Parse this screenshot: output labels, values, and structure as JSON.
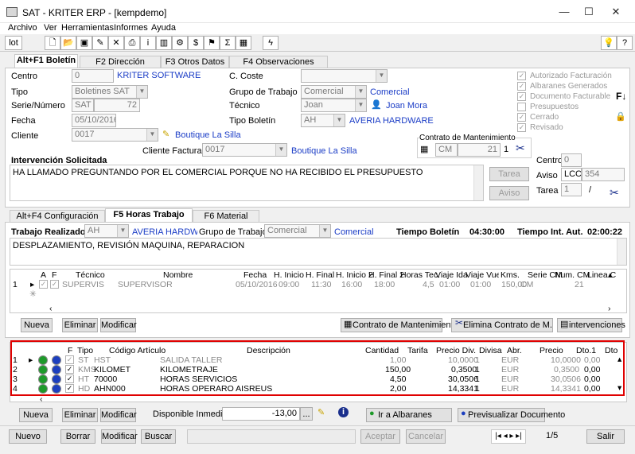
{
  "window": {
    "title": "SAT - KRITER ERP - [kempdemo]",
    "min": "—",
    "max": "☐",
    "close": "✕"
  },
  "menu": [
    "Archivo",
    "Ver",
    "Herramientas",
    "Informes",
    "Ayuda"
  ],
  "toolbar": {
    "lot": "lot"
  },
  "tabs_top": [
    "Alt+F1 Boletín",
    "F2 Dirección",
    "F3 Otros Datos",
    "F4 Observaciones"
  ],
  "header": {
    "centro_label": "Centro",
    "centro_value": "0",
    "centro_link": "KRITER SOFTWARE",
    "tipo_label": "Tipo",
    "tipo_value": "Boletines SAT",
    "serie_label": "Serie/Número",
    "serie_value": "SAT",
    "numero_value": "72",
    "fecha_label": "Fecha",
    "fecha_value": "05/10/2016",
    "cliente_label": "Cliente",
    "cliente_value": "0017",
    "cliente_link": "Boutique La Silla",
    "coste_label": "C. Coste",
    "grupo_label": "Grupo de Trabajo",
    "grupo_value": "Comercial",
    "grupo_link": "Comercial",
    "tecnico_label": "Técnico",
    "tecnico_value": "Joan",
    "tecnico_link": "Joan Mora",
    "tipobol_label": "Tipo Boletín",
    "tipobol_value": "AH",
    "tipobol_link": "AVERIA HARDWARE",
    "clifact_label": "Cliente Facturación",
    "clifact_value": "0017",
    "clifact_link": "Boutique La Silla"
  },
  "status_checks": [
    {
      "label": "Autorizado Facturación",
      "checked": true
    },
    {
      "label": "Albaranes Generados",
      "checked": true
    },
    {
      "label": "Documento Facturable",
      "checked": true
    },
    {
      "label": "Presupuestos",
      "checked": false
    },
    {
      "label": "Cerrado",
      "checked": true
    },
    {
      "label": "Revisado",
      "checked": true
    }
  ],
  "contrato": {
    "title": "Contrato de Mantenimiento",
    "code": "CM",
    "num": "21",
    "sub": "1"
  },
  "intervencion": {
    "label": "Intervención Solicitada",
    "text": "HA LLAMADO PREGUNTANDO POR EL COMERCIAL PORQUE NO HA RECIBIDO EL PRESUPUESTO",
    "tarea_btn": "Tarea",
    "aviso_btn": "Aviso"
  },
  "side": {
    "centro_label": "Centro",
    "centro_value": "0",
    "aviso_label": "Aviso",
    "aviso_code": "LCC",
    "aviso_num": "354",
    "tarea_label": "Tarea",
    "tarea_value": "1",
    "tarea_sep": "/"
  },
  "tabs_mid": [
    "Alt+F4 Configuración",
    "F5 Horas Trabajo",
    "F6 Material"
  ],
  "trabajo": {
    "label": "Trabajo Realizado",
    "tipo_value": "AH",
    "tipo_link": "AVERIA HARDWARE",
    "grupo_label": "Grupo de Trabajo",
    "grupo_value": "Comercial",
    "grupo_link": "Comercial",
    "tiempo_label": "Tiempo Boletín",
    "tiempo_value": "04:30:00",
    "int_label": "Tiempo Int. Aut.",
    "int_value": "02:00:22",
    "text": "DESPLAZAMIENTO, REVISIÓN MAQUINA, REPARACION"
  },
  "hours_table": {
    "headers": [
      "A",
      "F",
      "Técnico",
      "Nombre",
      "Fecha",
      "H. Inicio",
      "H. Final",
      "H. Inicio 2",
      "H. Final 2",
      "Horas Tec.",
      "Viaje Ida",
      "Viaje Vuelt",
      "Kms.",
      "Serie CM",
      "Num. CM",
      "Linea CM"
    ],
    "rows": [
      [
        "1",
        "SUPERVIS",
        "SUPERVISOR",
        "05/10/2016",
        "09:00",
        "11:30",
        "16:00",
        "18:00",
        "4,5",
        "01:00",
        "01:00",
        "150,00",
        "CM",
        "21"
      ]
    ],
    "new_marker": "✳"
  },
  "hours_buttons": {
    "nueva": "Nueva",
    "eliminar": "Eliminar",
    "modificar": "Modificar",
    "contrato": "Contrato de Mantenimiento",
    "elimina_contrato": "Elimina Contrato de M.",
    "intervenciones": "intervenciones"
  },
  "material_table": {
    "headers": [
      "F",
      "Tipo",
      "Código Artículo",
      "Descripción",
      "Cantidad",
      "Tarifa",
      "Precio Div.",
      "Divisa",
      "Abr.",
      "Precio",
      "Dto.1",
      "Dto"
    ],
    "rows": [
      {
        "n": "1",
        "tipo": "ST",
        "codigo": "HST",
        "desc": "SALIDA TALLER",
        "cant": "1,00",
        "precio_div": "10,0000",
        "divisa": "1",
        "abr": "EUR",
        "precio": "10,0000",
        "dto": "0,00",
        "grey": true
      },
      {
        "n": "2",
        "tipo": "KMS",
        "codigo": "KILOMET",
        "desc": "KILOMETRAJE",
        "cant": "150,00",
        "precio_div": "0,3500",
        "divisa": "1",
        "abr": "EUR",
        "precio": "0,3500",
        "dto": "0,00",
        "grey": false
      },
      {
        "n": "3",
        "tipo": "HT",
        "codigo": "70000",
        "desc": "HORAS SERVICIOS",
        "cant": "4,50",
        "precio_div": "30,0506",
        "divisa": "1",
        "abr": "EUR",
        "precio": "30,0506",
        "dto": "0,00",
        "grey": false
      },
      {
        "n": "4",
        "tipo": "HD",
        "codigo": "AHN000",
        "desc": "HORAS OPERARO AISREUS",
        "cant": "2,00",
        "precio_div": "14,3341",
        "divisa": "1",
        "abr": "EUR",
        "precio": "14,3341",
        "dto": "0,00",
        "grey": false
      }
    ]
  },
  "material_buttons": {
    "nueva": "Nueva",
    "eliminar": "Eliminar",
    "modificar": "Modificar",
    "disp_label": "Disponible Inmediato",
    "disp_value": "-13,00",
    "disp_more": "...",
    "albaranes": "Ir a Albaranes",
    "previsualizar": "Previsualizar Documento"
  },
  "footer": {
    "nuevo": "Nuevo",
    "borrar": "Borrar",
    "modificar": "Modificar",
    "buscar": "Buscar",
    "aceptar": "Aceptar",
    "cancelar": "Cancelar",
    "nav": "1/5",
    "salir": "Salir"
  },
  "colors": {
    "link": "#1a3cc6",
    "highlight": "#e00000",
    "green": "#1e9a2a",
    "blue": "#1d3fbf"
  }
}
